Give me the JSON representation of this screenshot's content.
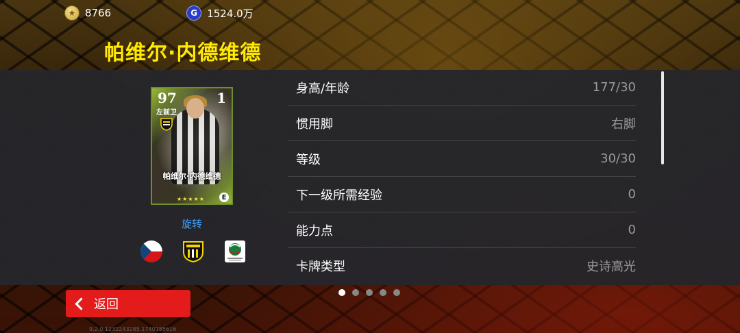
{
  "currency": {
    "coins": "8766",
    "gp": "1524.0万",
    "coin_icon": "coin-icon",
    "gp_icon": "gp-icon",
    "gp_letter": "G"
  },
  "player_name": "帕维尔·内德维德",
  "card": {
    "rating": "97",
    "level": "1",
    "position": "左前卫",
    "name": "帕维尔·内德维德",
    "stars": "★★★★★",
    "type_letter": "E",
    "frame_color": "#6f8f2a"
  },
  "rotate_label": "旋转",
  "stats": [
    {
      "label": "身高/年龄",
      "value": "177/30"
    },
    {
      "label": "惯用脚",
      "value": "右脚"
    },
    {
      "label": "等级",
      "value": "30/30"
    },
    {
      "label": "下一级所需经验",
      "value": "0"
    },
    {
      "label": "能力点",
      "value": "0"
    },
    {
      "label": "卡牌类型",
      "value": "史诗高光"
    }
  ],
  "pagination": {
    "total": 5,
    "active": 1
  },
  "back_label": "返回",
  "version": "9.2.0.1232243285.1740185616",
  "colors": {
    "title": "#ffea00",
    "back_button": "#e41b1b",
    "link": "#3fa0ff",
    "panel": "#26262a"
  },
  "badges": [
    "czech-flag-icon",
    "club-crest-icon",
    "league-logo-icon"
  ]
}
